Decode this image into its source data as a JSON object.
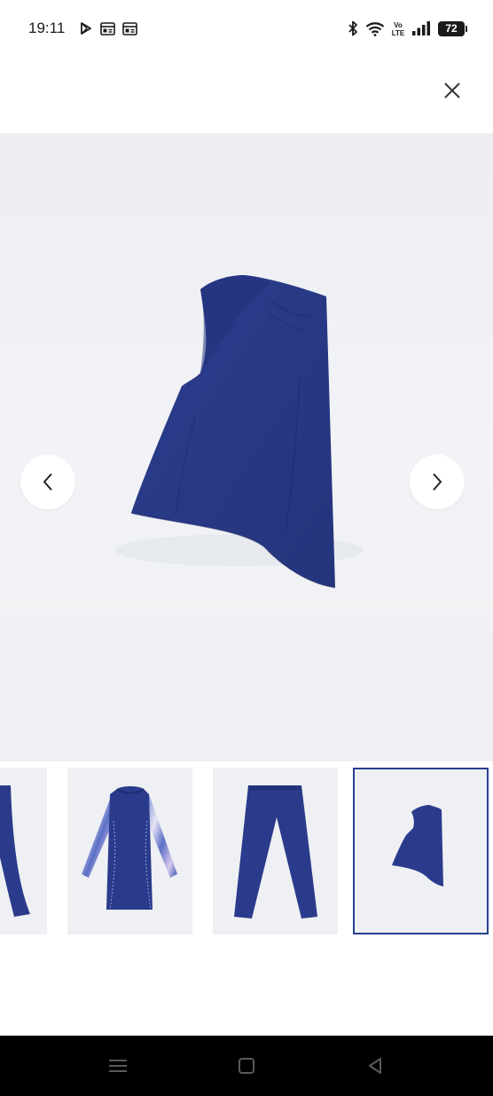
{
  "status_bar": {
    "time": "19:11",
    "battery": "72",
    "left_icons": [
      "play-store-icon",
      "news-icon",
      "news-icon"
    ],
    "right_icons": [
      "bluetooth-icon",
      "wifi-icon",
      "volte-icon",
      "signal-icon"
    ],
    "volte_label": "Vo\nLTE"
  },
  "gallery": {
    "thumb_count": 4,
    "active_index": 3,
    "thumbnails": [
      "swim-pants-partial",
      "swim-tunic",
      "swim-pants",
      "swim-hood"
    ]
  },
  "colors": {
    "garment": "#2a3a8a",
    "accent_border": "#2a3f8f"
  },
  "system_nav": [
    "menu-key",
    "home-key",
    "back-key"
  ]
}
